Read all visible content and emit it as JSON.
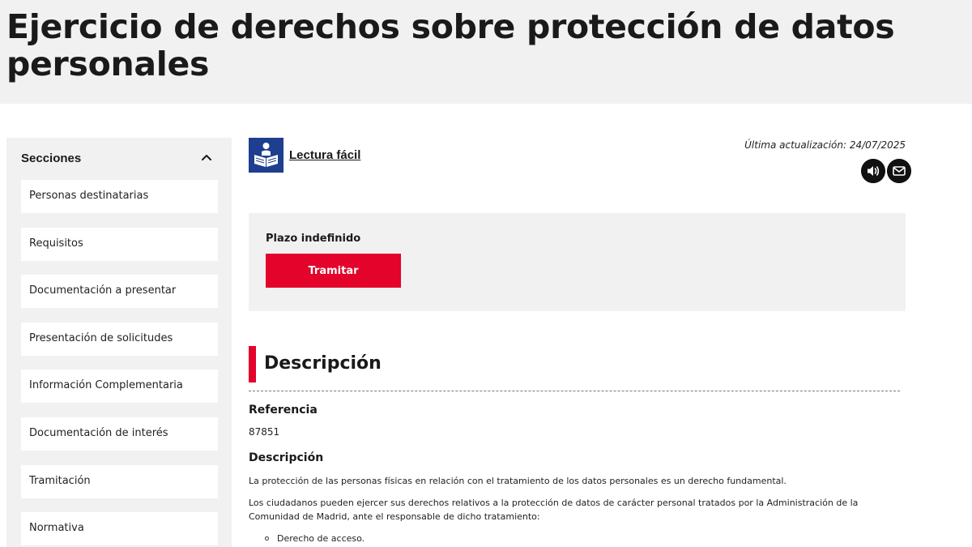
{
  "header": {
    "title": "Ejercicio de derechos sobre protección de datos personales"
  },
  "sidebar": {
    "title": "Secciones",
    "items": [
      "Personas destinatarias",
      "Requisitos",
      "Documentación a presentar",
      "Presentación de solicitudes",
      "Información Complementaria",
      "Documentación de interés",
      "Tramitación",
      "Normativa"
    ]
  },
  "easy_read": {
    "label": "Lectura fácil"
  },
  "updated": {
    "text": "Última actualización: 24/07/2025"
  },
  "actions": {
    "listen_icon": "speaker-icon",
    "email_icon": "envelope-icon"
  },
  "procedure": {
    "term": "Plazo indefinido",
    "button_label": "Tramitar"
  },
  "section": {
    "title": "Descripción",
    "reference_label": "Referencia",
    "reference_value": "87851",
    "description_label": "Descripción",
    "paragraph1": "La protección de las personas físicas en relación con el tratamiento de los datos personales es un derecho fundamental.",
    "paragraph2_line1": "Los ciudadanos pueden ejercer sus derechos relativos a la protección de datos de carácter personal tratados por la Administración de la",
    "paragraph2_line2": "Comunidad de Madrid, ante el responsable de dicho tratamiento:",
    "bullet1": "Derecho de acceso."
  },
  "colors": {
    "accent_red": "#e3032b",
    "panel_gray": "#f1f1f1",
    "easy_read_blue": "#1e3e8f"
  }
}
